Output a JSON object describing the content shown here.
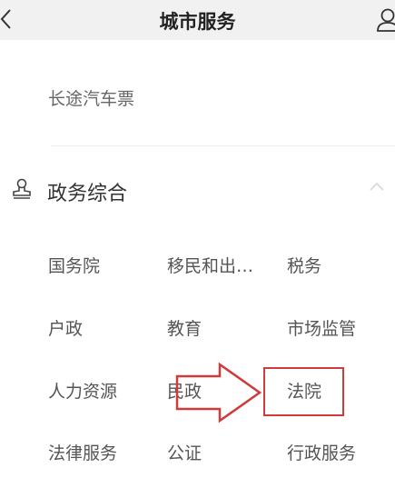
{
  "header": {
    "title": "城市服务",
    "back_icon": "chevron-left-icon",
    "profile_icon": "user-icon"
  },
  "transport": {
    "ticket_label": "长途汽车票"
  },
  "section": {
    "title": "政务综合",
    "icon": "stamp-icon",
    "collapse_icon": "chevron-up-icon",
    "items": [
      "国务院",
      "移民和出…",
      "税务",
      "户政",
      "教育",
      "市场监管",
      "人力资源",
      "民政",
      "法院",
      "法律服务",
      "公证",
      "行政服务"
    ]
  },
  "annotation": {
    "color": "#d03a3a",
    "target": "法院",
    "arrow_icon": "arrow-right-icon"
  }
}
